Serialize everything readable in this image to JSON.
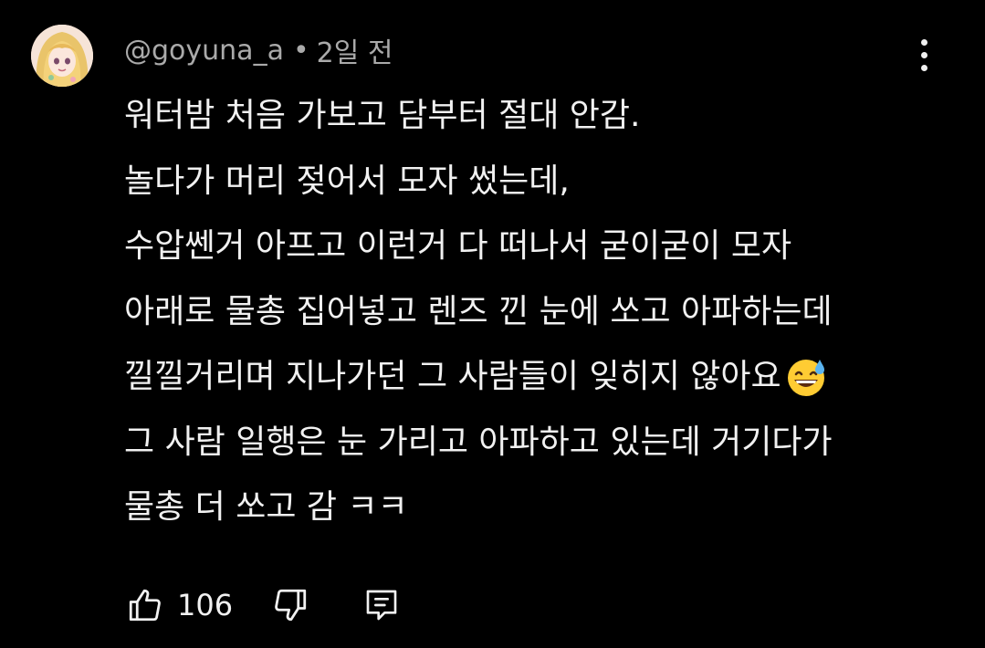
{
  "comment": {
    "author": "@goyuna_a",
    "separator": "•",
    "time_ago": "2일 전",
    "avatar_icon": "anime-girl-avatar",
    "lines": [
      "워터밤 처음 가보고 담부터 절대 안감.",
      "놀다가 머리 젖어서 모자 썼는데,",
      "수압쎈거 아프고 이런거 다 떠나서 굳이굳이 모자",
      "아래로 물총 집어넣고 렌즈 낀 눈에 쏘고 아파하는데",
      "낄낄거리며 지나가던 그 사람들이 잊히지 않아요",
      "그 사람 일행은 눈 가리고 아파하고 있는데 거기다가",
      "물총 더 쏘고 감 ㅋㅋ"
    ],
    "emoji": "grinning-face-with-sweat-emoji",
    "like_count": "106"
  },
  "icons": {
    "more": "more-vertical-icon",
    "like": "thumb-up-icon",
    "dislike": "thumb-down-icon",
    "reply": "reply-comment-icon"
  },
  "colors": {
    "background": "#000000",
    "text_primary": "#f1f1f1",
    "text_secondary": "#aaaaaa"
  }
}
